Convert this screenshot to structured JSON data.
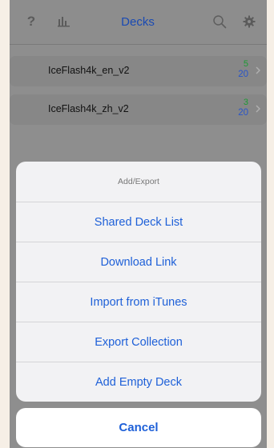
{
  "navbar": {
    "help_label": "?",
    "title": "Decks",
    "icons": [
      "help-icon",
      "stats-icon",
      "search-icon",
      "gear-icon"
    ]
  },
  "decks": [
    {
      "name": "IceFlash4k_en_v2",
      "due": "5",
      "new": "20"
    },
    {
      "name": "IceFlash4k_zh_v2",
      "due": "3",
      "new": "20"
    }
  ],
  "sheet": {
    "title": "Add/Export",
    "options": [
      "Shared Deck List",
      "Download Link",
      "Import from iTunes",
      "Export Collection",
      "Add Empty Deck"
    ],
    "cancel": "Cancel"
  },
  "colors": {
    "accent": "#1e60d8",
    "due_count": "#1c9b33",
    "new_count": "#2a55c9"
  }
}
